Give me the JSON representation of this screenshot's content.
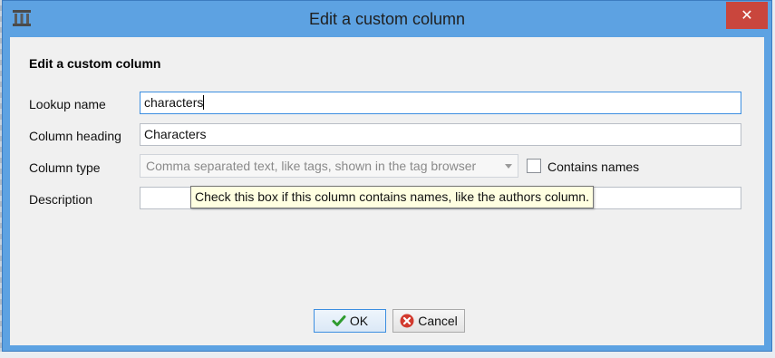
{
  "window": {
    "title": "Edit a custom column"
  },
  "dialog": {
    "section_title": "Edit a custom column",
    "lookup_name": {
      "label": "Lookup name",
      "value": "characters"
    },
    "column_heading": {
      "label": "Column heading",
      "value": "Characters"
    },
    "column_type": {
      "label": "Column type",
      "selected": "Comma separated text, like tags, shown in the tag browser",
      "checkbox_label": "Contains names",
      "checkbox_checked": false
    },
    "description": {
      "label": "Description",
      "value": ""
    },
    "tooltip": "Check this box if this column contains names, like the authors column.",
    "buttons": {
      "ok": "OK",
      "cancel": "Cancel"
    }
  },
  "colors": {
    "titlebar": "#5da2e2",
    "close_button": "#c9463d",
    "focus_border": "#3c8ee0",
    "tooltip_bg": "#ffffe1"
  },
  "icons": {
    "app": "calibre-library-icon",
    "close": "close-icon",
    "ok": "checkmark-icon",
    "cancel": "cancel-icon"
  }
}
